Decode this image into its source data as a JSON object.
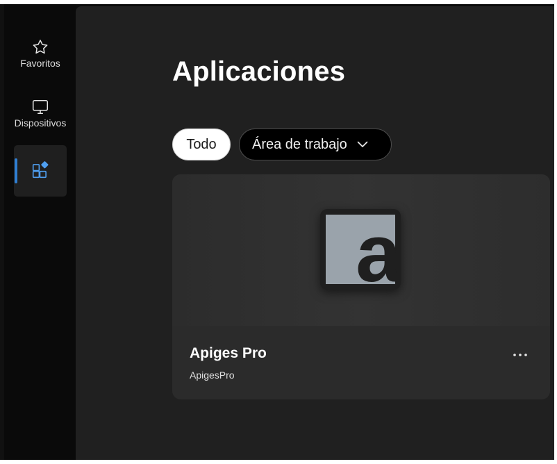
{
  "sidebar": {
    "items": [
      {
        "label": "Favoritos",
        "icon": "star-icon"
      },
      {
        "label": "Dispositivos",
        "icon": "monitor-icon"
      },
      {
        "label": "",
        "icon": "apps-icon",
        "active": true
      }
    ]
  },
  "main": {
    "title": "Aplicaciones",
    "filters": {
      "all_label": "Todo",
      "dropdown_label": "Área de trabajo"
    },
    "cards": [
      {
        "name": "Apiges Pro",
        "publisher": "ApigesPro",
        "logo_letter": "a"
      }
    ]
  },
  "colors": {
    "accent": "#2f7fd3",
    "background": "#202020",
    "sidebar": "#0a0a0a",
    "card": "#2b2b2b",
    "logo_tile": "#9aa3ab"
  }
}
